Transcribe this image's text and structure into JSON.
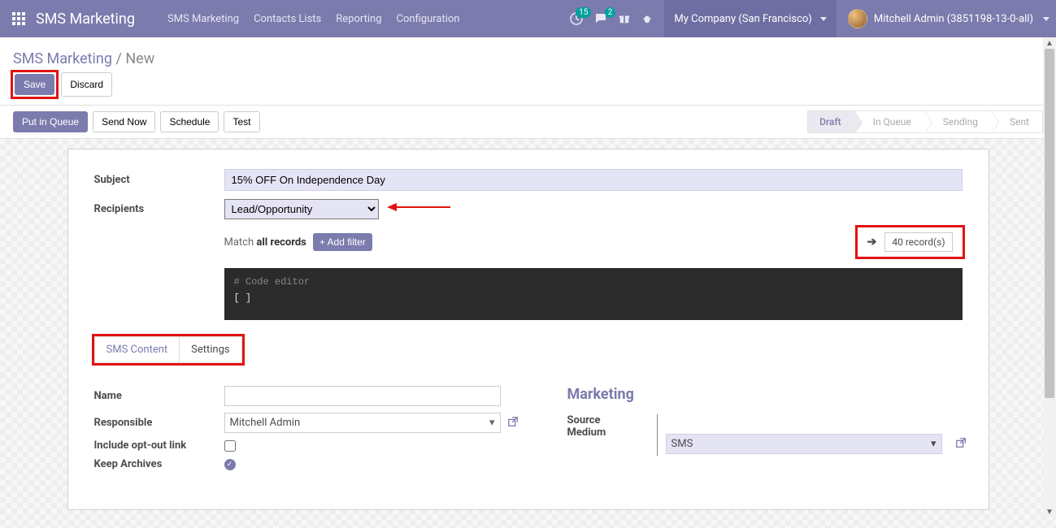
{
  "nav": {
    "brand": "SMS Marketing",
    "links": [
      "SMS Marketing",
      "Contacts Lists",
      "Reporting",
      "Configuration"
    ],
    "activity_badge": "15",
    "messages_badge": "2",
    "company": "My Company (San Francisco)",
    "user": "Mitchell Admin (3851198-13-0-all)"
  },
  "breadcrumb": {
    "root": "SMS Marketing",
    "current": "New"
  },
  "actions": {
    "save": "Save",
    "discard": "Discard"
  },
  "buttons": {
    "put_in_queue": "Put in Queue",
    "send_now": "Send Now",
    "schedule": "Schedule",
    "test": "Test"
  },
  "status": {
    "steps": [
      "Draft",
      "In Queue",
      "Sending",
      "Sent"
    ],
    "active": "Draft"
  },
  "form": {
    "subject_label": "Subject",
    "subject_value": "15% OFF On Independence Day",
    "recipients_label": "Recipients",
    "recipients_value": "Lead/Opportunity",
    "match_prefix": "Match ",
    "match_bold": "all records",
    "add_filter": "+ Add filter",
    "records_count": "40 record(s)",
    "code_comment": "# Code editor",
    "code_body": "[ ]"
  },
  "tabs": {
    "items": [
      "SMS Content",
      "Settings"
    ],
    "active": "SMS Content"
  },
  "settings": {
    "name_label": "Name",
    "name_value": "",
    "responsible_label": "Responsible",
    "responsible_value": "Mitchell Admin",
    "optout_label": "Include opt-out link",
    "optout_checked": false,
    "archives_label": "Keep Archives",
    "archives_checked": true
  },
  "marketing": {
    "title": "Marketing",
    "source_label": "Source",
    "source_value": "",
    "medium_label": "Medium",
    "medium_value": "SMS"
  }
}
